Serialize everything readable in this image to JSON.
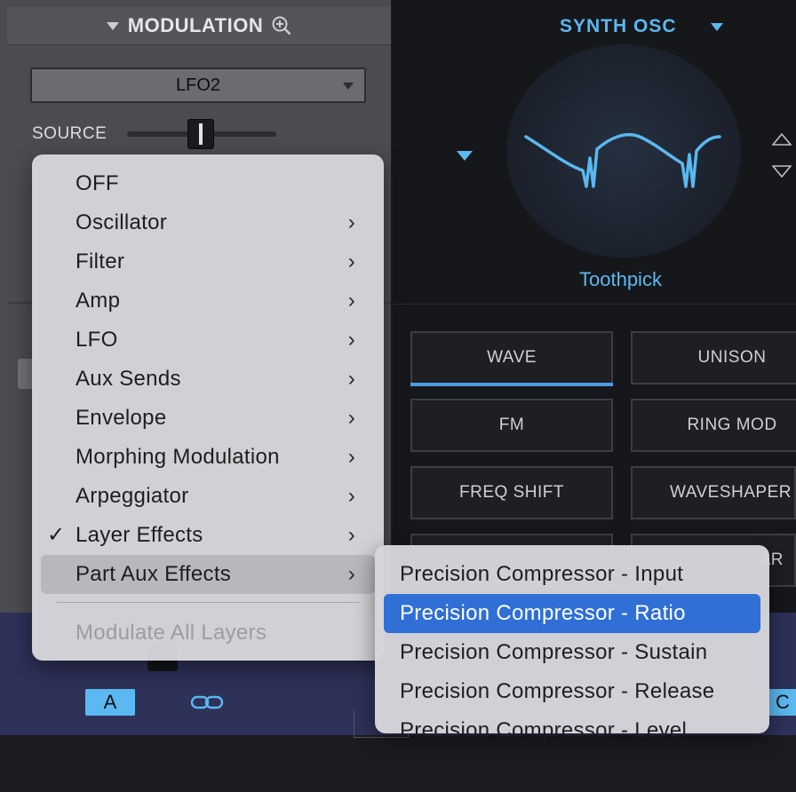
{
  "modulation": {
    "title": "MODULATION",
    "lfo_value": "LFO2",
    "source_label": "SOURCE"
  },
  "synth_osc": {
    "title": "SYNTH OSC",
    "waveform_name": "Toothpick",
    "buttons": [
      "WAVE",
      "UNISON",
      "FM",
      "RING MOD",
      "FREQ SHIFT",
      "WAVESHAPER",
      "",
      "AR"
    ]
  },
  "layers": {
    "a_label": "A",
    "c_label": "C"
  },
  "menu": {
    "items": [
      {
        "label": "OFF"
      },
      {
        "label": "Oscillator"
      },
      {
        "label": "Filter"
      },
      {
        "label": "Amp"
      },
      {
        "label": "LFO"
      },
      {
        "label": "Aux Sends"
      },
      {
        "label": "Envelope"
      },
      {
        "label": "Morphing Modulation"
      },
      {
        "label": "Arpeggiator"
      },
      {
        "label": "Layer Effects"
      },
      {
        "label": "Part Aux Effects"
      }
    ],
    "modulate_all": "Modulate All Layers",
    "chevron": "›",
    "check": "✓"
  },
  "submenu": {
    "items": [
      {
        "label": "Precision Compressor - Input"
      },
      {
        "label": "Precision Compressor - Ratio"
      },
      {
        "label": "Precision Compressor - Sustain"
      },
      {
        "label": "Precision Compressor - Release"
      },
      {
        "label": "Precision Compressor - Level"
      }
    ]
  },
  "colors": {
    "accent": "#5bb8f0",
    "selection": "#2f6fd6",
    "strip": "#2e3158"
  }
}
